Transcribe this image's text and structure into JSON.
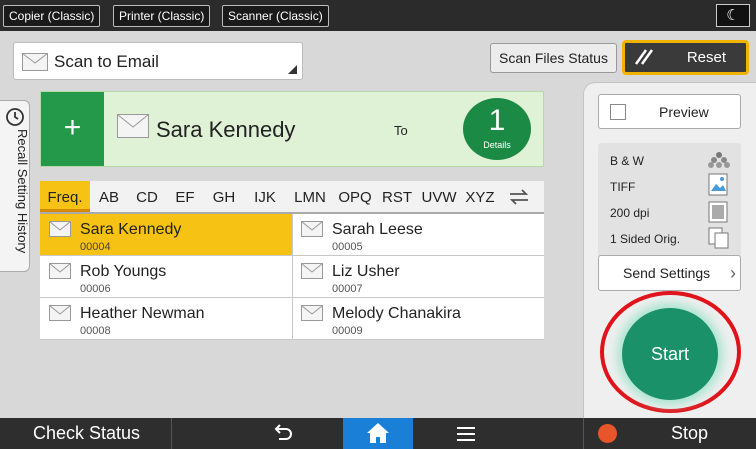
{
  "top_bar": {
    "mode_tabs": [
      "Copier (Classic)",
      "Printer (Classic)",
      "Scanner (Classic)"
    ],
    "night_icon": "moon-icon"
  },
  "app": {
    "name": "Scan to Email",
    "icon": "envelope-icon"
  },
  "header_buttons": {
    "scan_files_status": "Scan Files Status",
    "reset": "Reset"
  },
  "recall": {
    "label": "Recall Setting History",
    "icon": "clock-icon"
  },
  "destination": {
    "name": "Sara Kennedy",
    "field_label": "To",
    "count": "1",
    "details_label": "Details"
  },
  "index_tabs": [
    "Freq.",
    "AB",
    "CD",
    "EF",
    "GH",
    "IJK",
    "LMN",
    "OPQ",
    "RST",
    "UVW",
    "XYZ"
  ],
  "active_index": "Freq.",
  "address_book": [
    {
      "name": "Sara Kennedy",
      "id": "00004",
      "selected": true
    },
    {
      "name": "Sarah Leese",
      "id": "00005",
      "selected": false
    },
    {
      "name": "Rob Youngs",
      "id": "00006",
      "selected": false
    },
    {
      "name": "Liz Usher",
      "id": "00007",
      "selected": false
    },
    {
      "name": "Heather Newman",
      "id": "00008",
      "selected": false
    },
    {
      "name": "Melody Chanakira",
      "id": "00009",
      "selected": false
    }
  ],
  "right_panel": {
    "preview": "Preview",
    "settings": [
      {
        "label": "B & W",
        "icon": "color-dots-icon"
      },
      {
        "label": "TIFF",
        "icon": "image-file-icon"
      },
      {
        "label": "200 dpi",
        "icon": "resolution-icon"
      },
      {
        "label": "1 Sided Orig.",
        "icon": "single-sided-icon"
      }
    ],
    "send_settings": "Send Settings",
    "start": "Start"
  },
  "bottom_bar": {
    "check_status": "Check Status",
    "stop": "Stop"
  },
  "colors": {
    "accent_yellow": "#f6c315",
    "green": "#25994a",
    "start_teal": "#1a9168",
    "highlight_red": "#e0121a",
    "home_blue": "#1a7fd6"
  }
}
